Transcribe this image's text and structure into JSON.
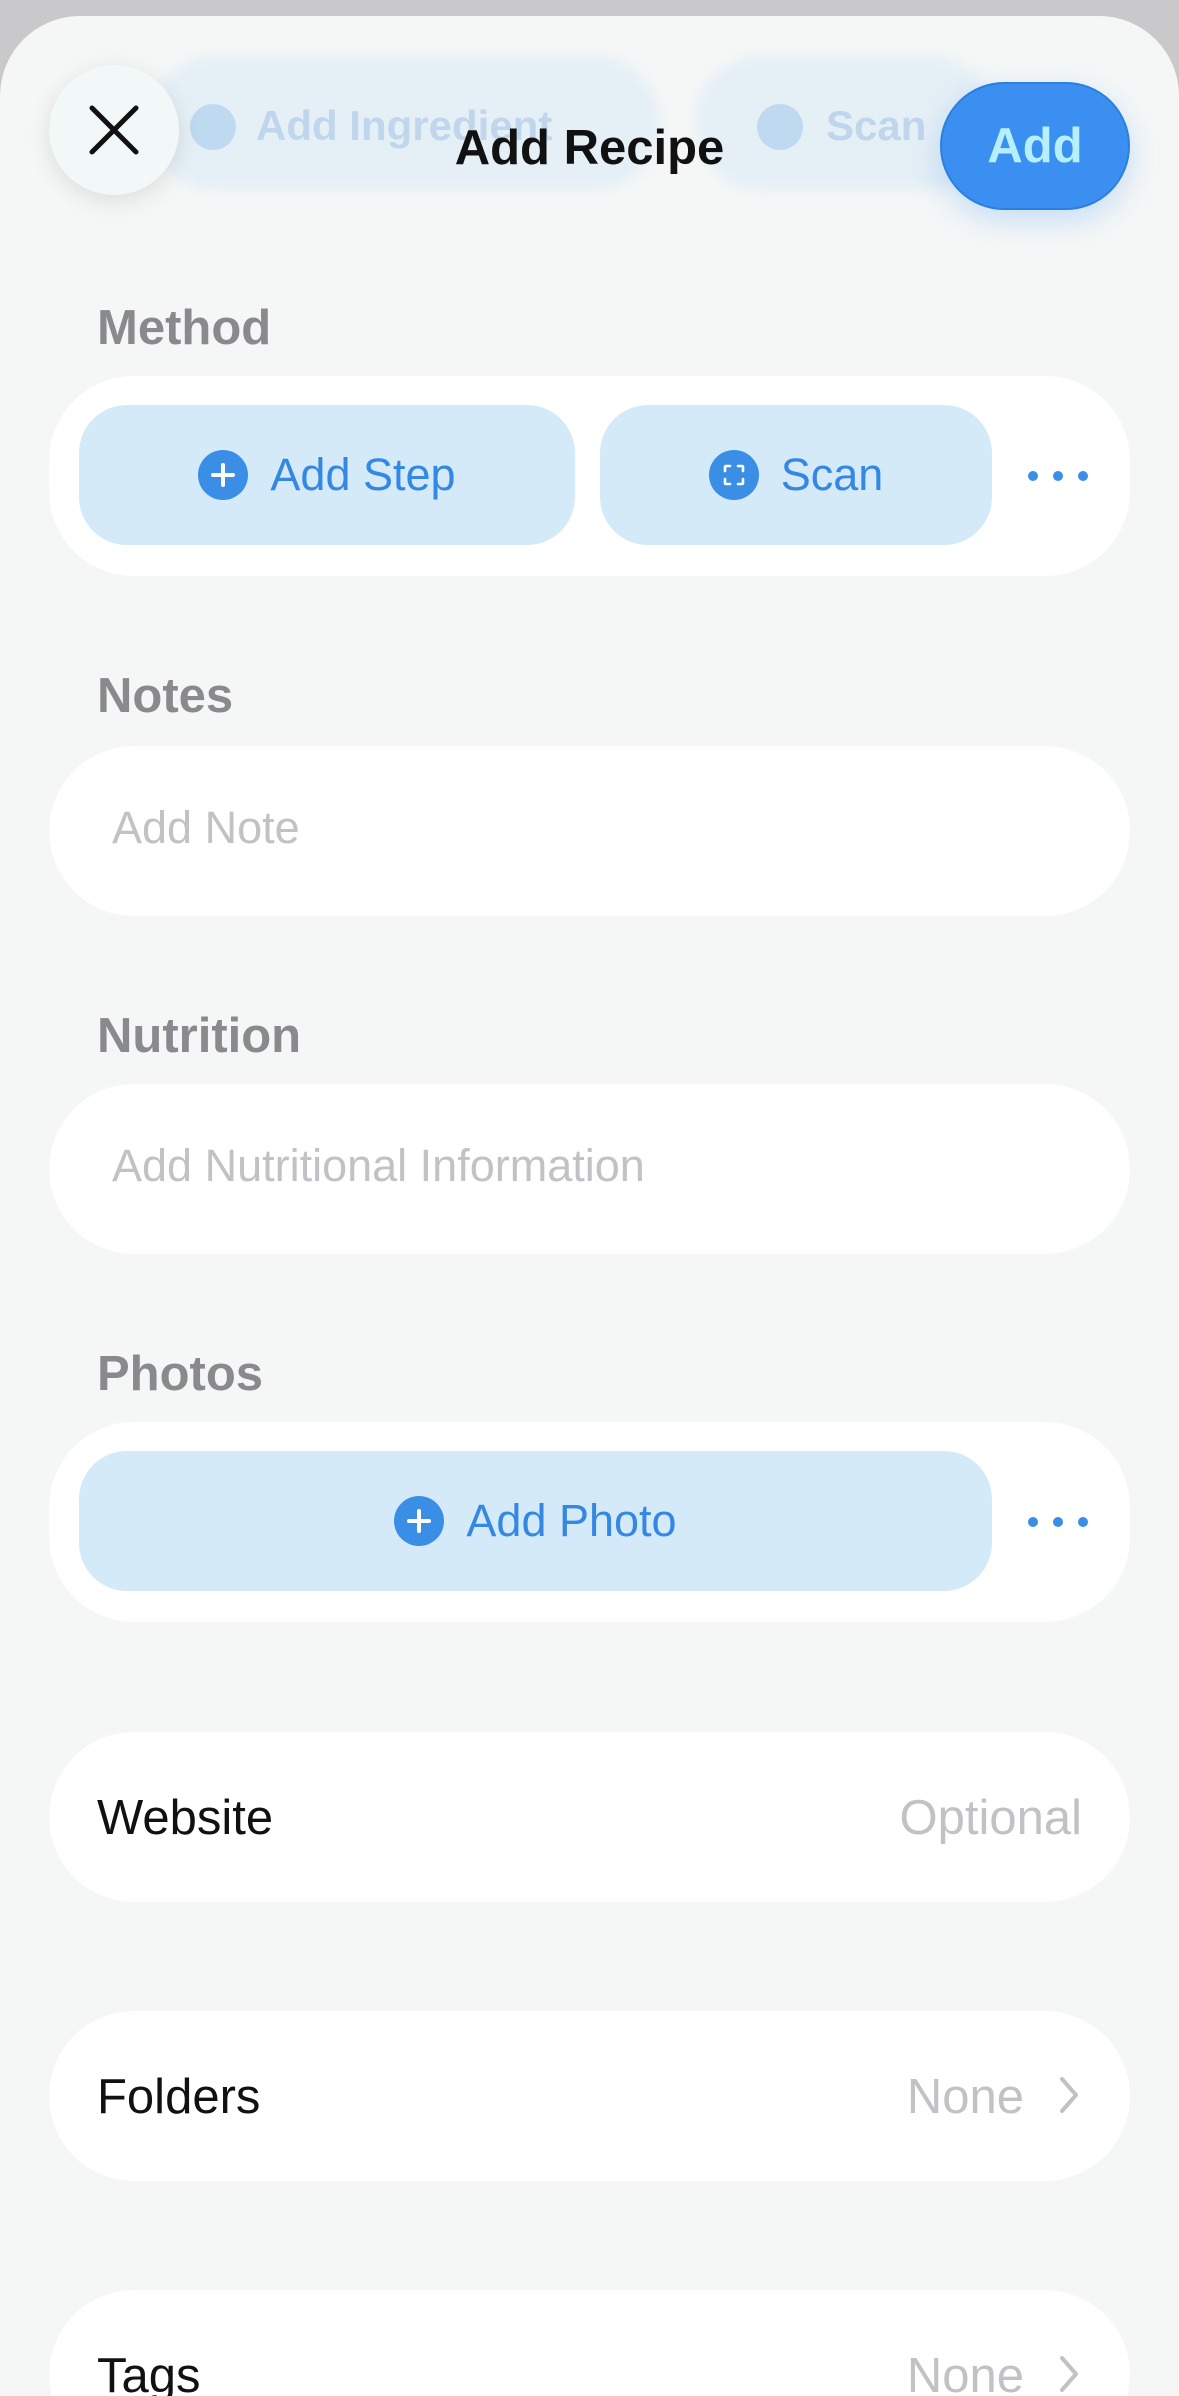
{
  "header": {
    "title": "Add Recipe",
    "add_label": "Add",
    "ghost_left": "Add Ingredient",
    "ghost_right": "Scan"
  },
  "method": {
    "label": "Method",
    "add_step_label": "Add Step",
    "scan_label": "Scan"
  },
  "notes": {
    "label": "Notes",
    "placeholder": "Add Note"
  },
  "nutrition": {
    "label": "Nutrition",
    "placeholder": "Add Nutritional Information"
  },
  "photos": {
    "label": "Photos",
    "add_photo_label": "Add Photo"
  },
  "website": {
    "label": "Website",
    "value": "Optional"
  },
  "folders": {
    "label": "Folders",
    "value": "None"
  },
  "tags": {
    "label": "Tags",
    "value": "None"
  },
  "colors": {
    "accent": "#3a8ff0",
    "pill_background": "#d4eaf8",
    "page_background": "#f5f7f7"
  }
}
